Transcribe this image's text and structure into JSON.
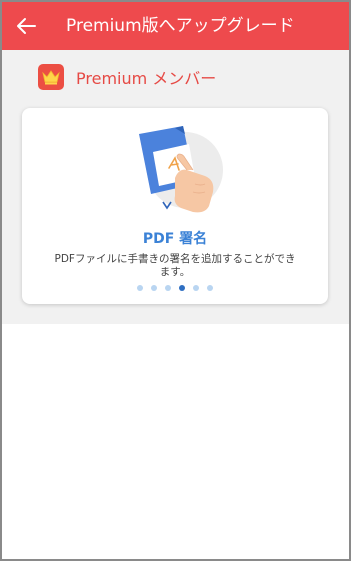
{
  "appbar": {
    "title": "Premium版へアップグレード",
    "back_icon": "arrow-left-icon",
    "background": "#ee4a4d"
  },
  "member": {
    "badge_icon": "crown-icon",
    "label": "Premium メンバー",
    "accent": "#e64a45"
  },
  "feature": {
    "illustration_icon": "pdf-signature-illustration",
    "title": "PDF 署名",
    "description": "PDFファイルに手書きの署名を追加することができます。",
    "title_color": "#3b82d6"
  },
  "carousel": {
    "total": 6,
    "active_index": 3
  }
}
